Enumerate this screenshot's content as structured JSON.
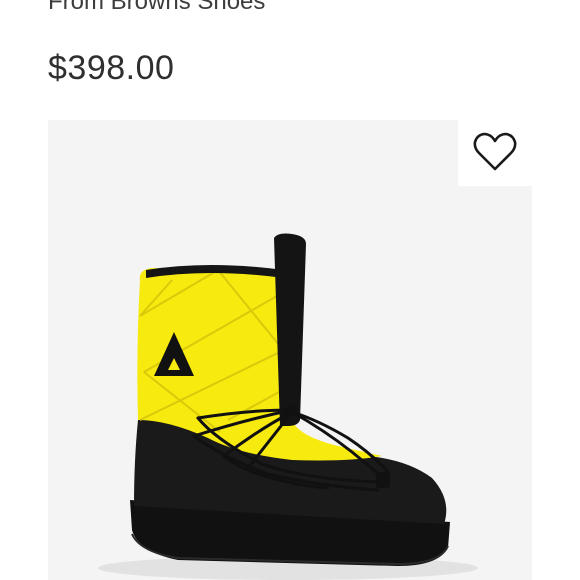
{
  "listing": {
    "seller_line": "From Browns Shoes",
    "price": "$398.00"
  },
  "product_image": {
    "subject": "boot",
    "colors": {
      "nylon": "#f7ea0f",
      "nylon_shadow": "#d9c90a",
      "rubber": "#151515",
      "background": "#f4f4f4"
    }
  },
  "favorite": {
    "icon": "heart-outline-icon"
  }
}
